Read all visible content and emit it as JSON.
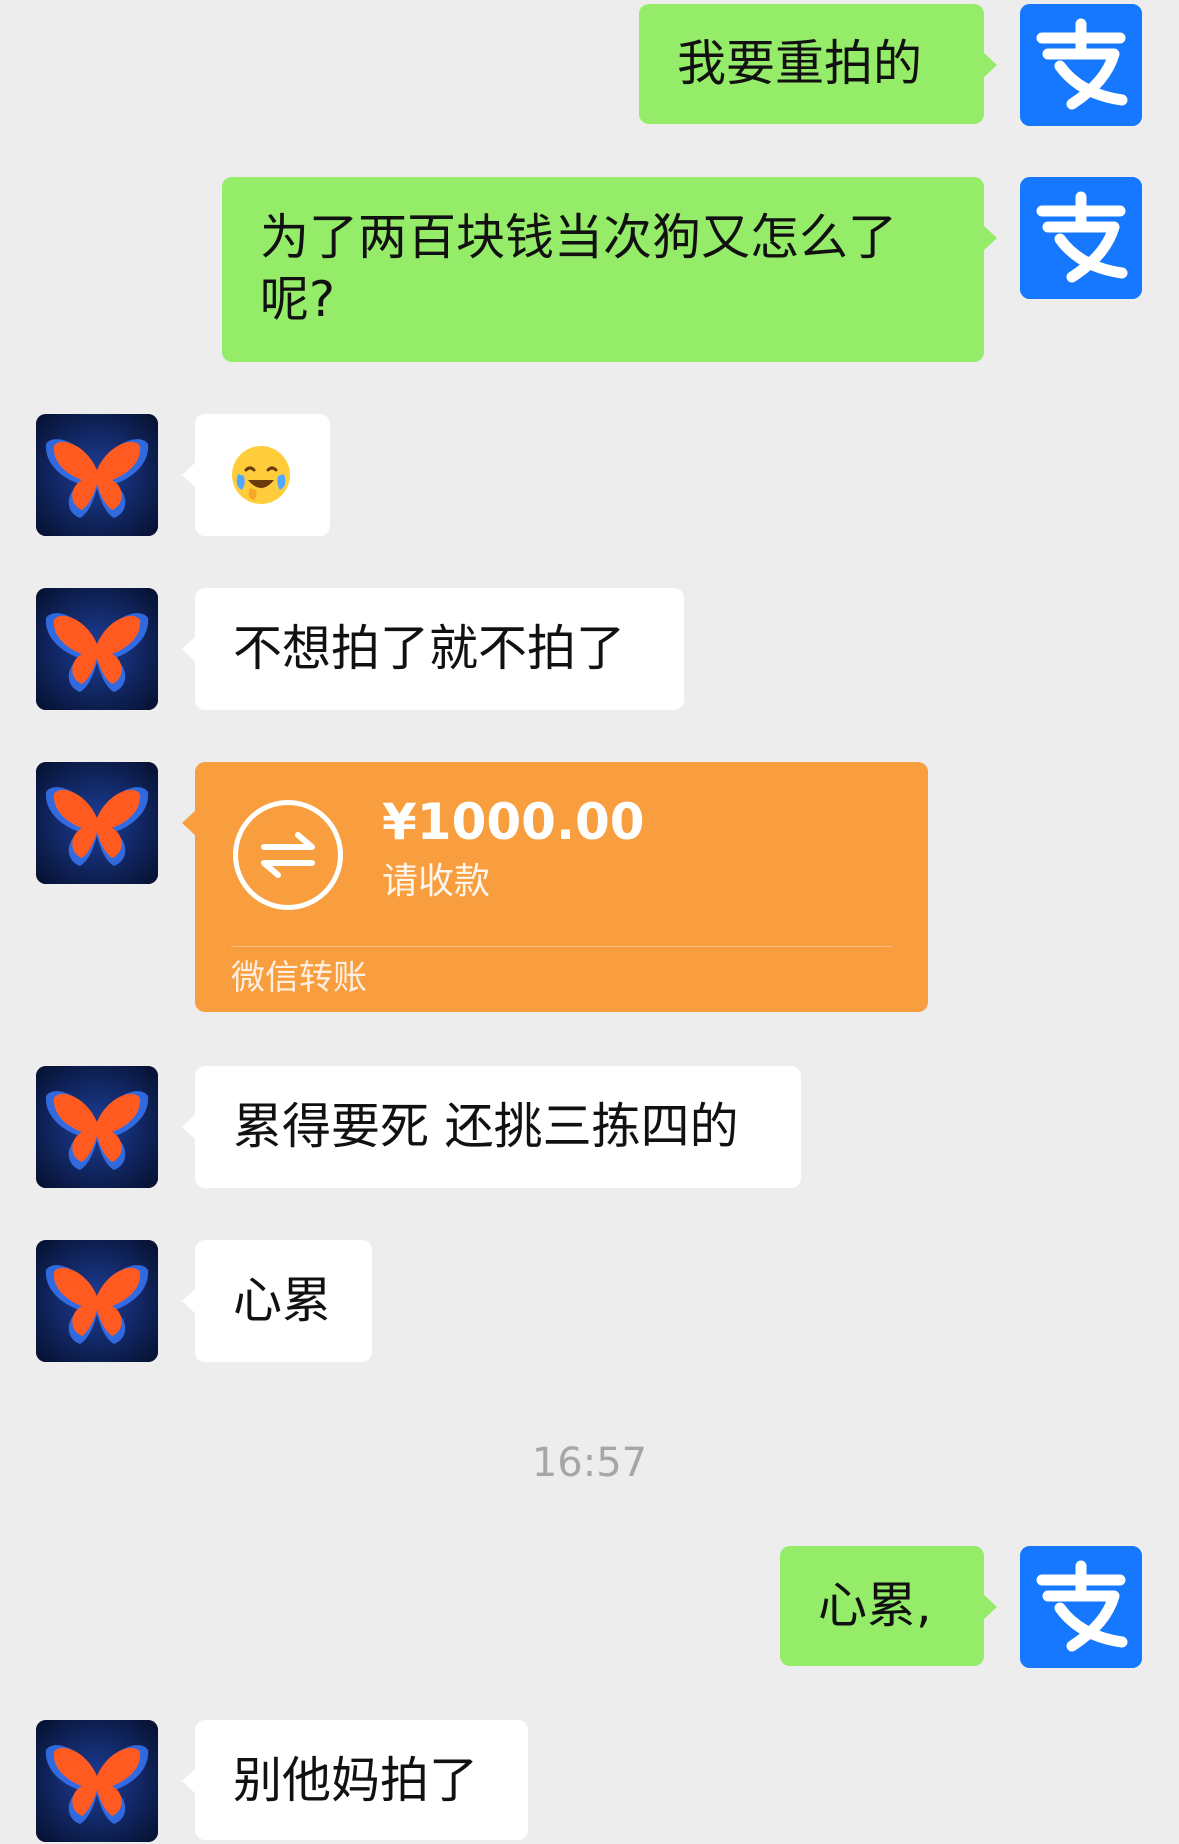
{
  "messages": [
    {
      "side": "right",
      "text": "我要重拍的"
    },
    {
      "side": "right",
      "text": " 为了两百块钱当次狗又怎么了呢?"
    },
    {
      "side": "left",
      "emoji": "rolling-on-floor-laughing-crying-emoji"
    },
    {
      "side": "left",
      "text": "不想拍了就不拍了"
    },
    {
      "side": "left",
      "transfer": {
        "amount": "¥1000.00",
        "status": "请收款",
        "label": "微信转账"
      }
    },
    {
      "side": "left",
      "text": "累得要死 还挑三拣四的"
    },
    {
      "side": "left",
      "text": "心累"
    },
    {
      "side": "right",
      "text": "心累,"
    },
    {
      "side": "left",
      "text": "别他妈拍了"
    }
  ],
  "timestamp": "16:57",
  "colors": {
    "background": "#ededed",
    "sent_bubble": "#95ec69",
    "received_bubble": "#ffffff",
    "transfer_card": "#f89e3e",
    "alipay_blue": "#1677ff"
  },
  "icons": {
    "right_avatar": "alipay-logo-icon",
    "left_avatar": "butterfly-icon",
    "transfer": "transfer-arrows-icon"
  }
}
